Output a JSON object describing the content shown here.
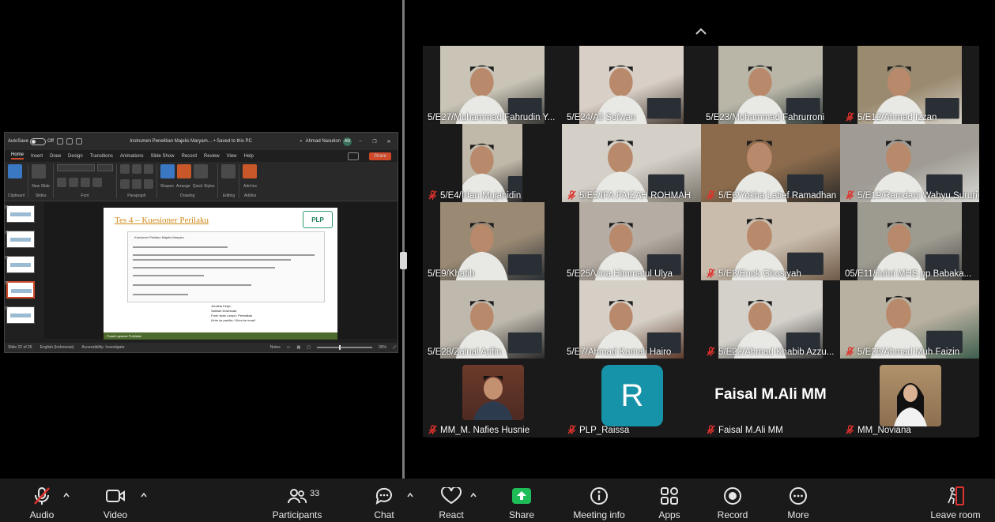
{
  "colors": {
    "accent_orange": "#d04a2a",
    "mute_red": "#e0322e",
    "share_green": "#1fbd58",
    "gallery_bg": "#1a1a1a"
  },
  "shared_screen": {
    "app": {
      "autosave_label": "AutoSave",
      "toggle_state": "Off",
      "doc_title": "Instrumen Penelitian Majelis Maryam… • Saved to this PC",
      "user_name": "Ahmad Nasution",
      "user_initials": "AN",
      "tabs": [
        "Home",
        "Insert",
        "Draw",
        "Design",
        "Transitions",
        "Animations",
        "Slide Show",
        "Record",
        "Review",
        "View",
        "Help"
      ],
      "active_tab": "Home",
      "share_label": "Share",
      "ribbon_groups": [
        "Clipboard",
        "Slides",
        "Font",
        "Paragraph",
        "Drawing",
        "Addins"
      ],
      "ribbon_buttons": [
        "New Slide",
        "Shapes",
        "Arrange",
        "Quick Styles",
        "Editing",
        "Add-ins"
      ],
      "thumb_numbers": [
        "19",
        "20",
        "21",
        "22",
        "23"
      ]
    },
    "slide": {
      "title": "Tes 4 – Kuesioner Perilaku",
      "logo_text": "PLP",
      "form_title": "Kuesioner Perilaku Majelis Maryam",
      "list_items": [
        "Jendela Kerja :",
        "Salinan Download",
        "Form Isian Lanjut / Perbaikan",
        "Kirim ke panitia / Kirim ke email"
      ],
      "footer_text": "Pusat Layanan Publikasi"
    },
    "status": {
      "slide_counter": "Slide 22 of 26",
      "language": "English (Indonesia)",
      "accessibility": "Accessibility: Investigate",
      "notes": "Notes",
      "zoom": "35%"
    }
  },
  "gallery": {
    "participants": [
      {
        "name": "5/E27/Muhammad Fahrudin Y...",
        "muted": false
      },
      {
        "name": "5/E24/Ali Sofwan",
        "muted": false
      },
      {
        "name": "5/E23/Mohammad Fahrurroni",
        "muted": false
      },
      {
        "name": "5/E12/Ahmad Izzan",
        "muted": true
      },
      {
        "name": "5/E4/Irfan Mujahidin",
        "muted": true
      },
      {
        "name": "5/E5/IFA FAIZAH ROHMAH",
        "muted": true
      },
      {
        "name": "5/E6/Yokha Latief Ramadhan",
        "muted": true
      },
      {
        "name": "5/E19/Ramdani Wahyu Sururie",
        "muted": true
      },
      {
        "name": "5/E9/Khatib",
        "muted": false
      },
      {
        "name": "5/E25/Vina Himmatul Ulya",
        "muted": false
      },
      {
        "name": "5/E8/Enok Ghosiyah",
        "muted": true
      },
      {
        "name": "05/E11/Juhri MHS pp Babaka...",
        "muted": false
      },
      {
        "name": "5/E28/Zainal Arifin",
        "muted": false
      },
      {
        "name": "5/E7/Ahmad Kamali Hairo",
        "muted": false
      },
      {
        "name": "5/E22/Ahmad Khabib Azzu...",
        "muted": true
      },
      {
        "name": "5/E26/Ahmad Muh Faizin",
        "muted": true
      },
      {
        "name": "MM_M. Nafies Husnie",
        "muted": true
      },
      {
        "name": "PLP_Raissa",
        "muted": true
      },
      {
        "name": "Faisal M.Ali MM",
        "muted": true
      },
      {
        "name": "MM_Noviana",
        "muted": true
      }
    ],
    "raissa_initial": "R",
    "faisal_display": "Faisal M.Ali MM"
  },
  "toolbar": {
    "audio": "Audio",
    "video": "Video",
    "participants": "Participants",
    "participants_count": "33",
    "chat": "Chat",
    "react": "React",
    "share": "Share",
    "meeting_info": "Meeting info",
    "apps": "Apps",
    "record": "Record",
    "more": "More",
    "leave": "Leave room"
  }
}
